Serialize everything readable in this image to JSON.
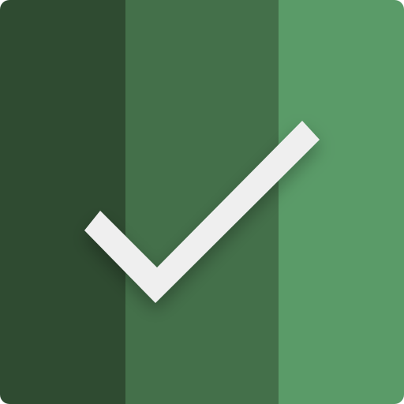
{
  "icon": {
    "name": "checkmark-icon",
    "colors": {
      "band_left": "#2f4b31",
      "band_middle": "#44704a",
      "band_right": "#5a9b68",
      "check": "#efefef",
      "shadow": "#000000"
    }
  }
}
